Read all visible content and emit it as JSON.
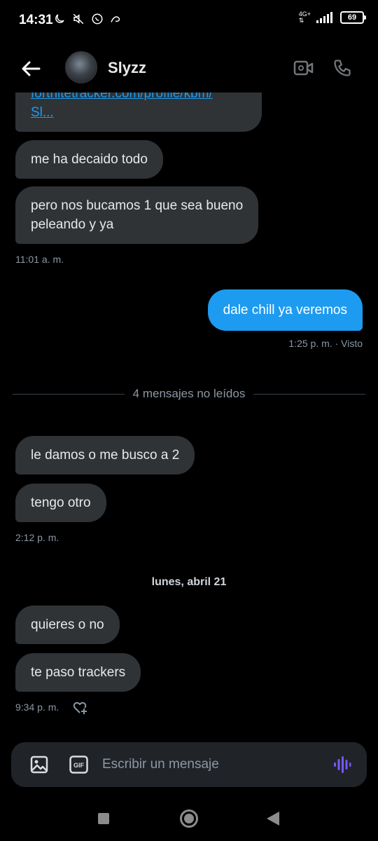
{
  "status_bar": {
    "time": "14:31",
    "network": "4G+",
    "battery": "69"
  },
  "header": {
    "contact_name": "Slyzz",
    "icons": [
      "back-arrow-icon",
      "video-call-icon",
      "phone-call-icon"
    ]
  },
  "messages": {
    "m1_link_line1": "fortnitetracker.com/profile/kbm/",
    "m1_link_line2": "Sl...",
    "m2": "me ha decaido todo",
    "m3_line1": "pero nos bucamos 1 que sea bueno",
    "m3_line2": "peleando y ya",
    "t1": "11:01 a. m.",
    "m4": "dale chill ya veremos",
    "t2": "1:25 p. m. · Visto",
    "unread_divider": "4 mensajes no leídos",
    "m5": "le damos o me busco a 2",
    "m6": "tengo otro",
    "t3": "2:12 p. m.",
    "date_separator": "lunes, abril 21",
    "m7": "quieres o no",
    "m8": "te paso trackers",
    "t4": "9:34 p. m."
  },
  "composer": {
    "placeholder": "Escribir un mensaje",
    "gif_label": "GIF"
  },
  "colors": {
    "background": "#000000",
    "incoming_bubble": "#2f3336",
    "outgoing_bubble": "#1d9bf0",
    "link": "#1d9bf0",
    "voice_accent": "#7856ff"
  }
}
